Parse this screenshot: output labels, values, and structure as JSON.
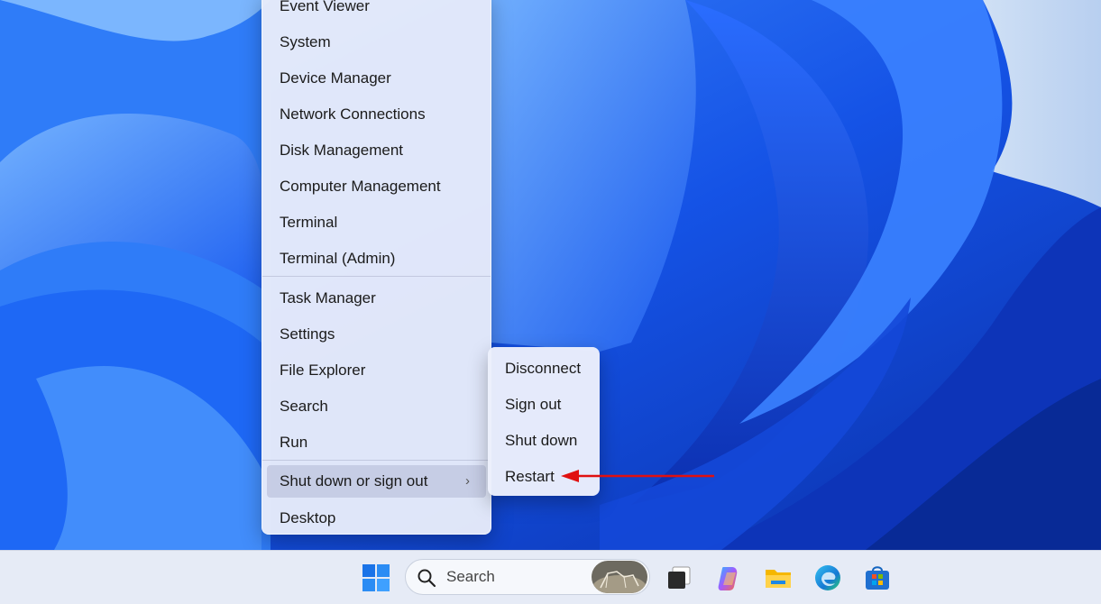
{
  "context_menu": {
    "items": [
      "Event Viewer",
      "System",
      "Device Manager",
      "Network Connections",
      "Disk Management",
      "Computer Management",
      "Terminal",
      "Terminal (Admin)",
      "Task Manager",
      "Settings",
      "File Explorer",
      "Search",
      "Run",
      "Shut down or sign out",
      "Desktop"
    ],
    "active_item": "Shut down or sign out"
  },
  "submenu": {
    "items": [
      "Disconnect",
      "Sign out",
      "Shut down",
      "Restart"
    ]
  },
  "annotation": {
    "arrow_color": "#e01010",
    "points_to": "Restart"
  },
  "taskbar": {
    "search_placeholder": "Search",
    "icons": [
      "start-icon",
      "search-icon",
      "task-view-icon",
      "copilot-icon",
      "file-explorer-icon",
      "edge-icon",
      "store-icon"
    ]
  },
  "colors": {
    "accent": "#0a5cd6",
    "wallpaper_blue": "#1a5ff0"
  }
}
